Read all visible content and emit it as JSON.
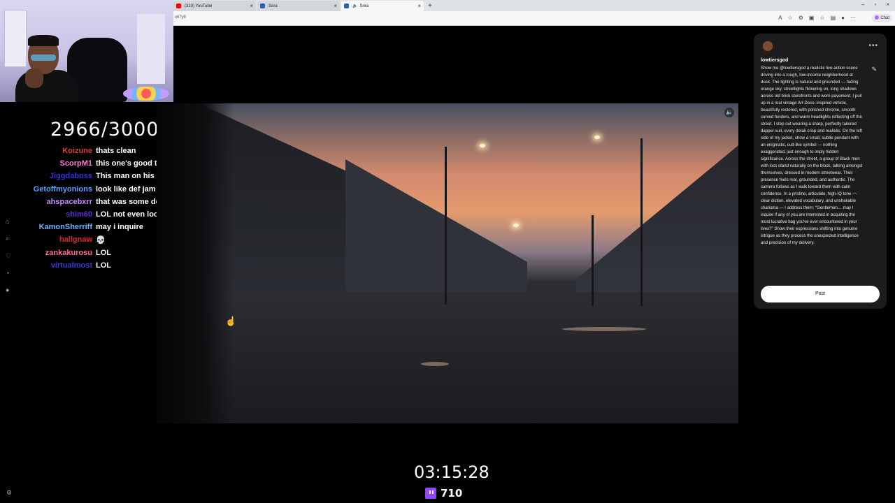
{
  "browser": {
    "tabs": [
      {
        "label": "(310) YouTube",
        "favicon_color": "#ff0000",
        "active": false,
        "audio": false
      },
      {
        "label": "Sora",
        "favicon_color": "#2f5fa8",
        "active": false,
        "audio": false
      },
      {
        "label": "Sora",
        "favicon_color": "#2f5fa8",
        "active": true,
        "audio": true
      }
    ],
    "url_fragment": "x67y8",
    "chat_button": "Chat"
  },
  "overlay": {
    "goal": "2966/3000",
    "timer": "03:15:28",
    "viewers": "710"
  },
  "chat": [
    {
      "user": "Koizune",
      "color": "#e03a3a",
      "message": "thats clean"
    },
    {
      "user": "ScorpM1",
      "color": "#ff7ad9",
      "message": "this one's good tho"
    },
    {
      "user": "Jiggdaboss",
      "color": "#3a2fd8",
      "message": "This man on his Ghost shit"
    },
    {
      "user": "Getoffmyonions",
      "color": "#5aa2ff",
      "message": "look like def jam fight for NY"
    },
    {
      "user": "ahspacebxrr",
      "color": "#c28aff",
      "message": "that was some def jam type shit"
    },
    {
      "user": "shim60",
      "color": "#5b2fd0",
      "message": "LOL not even looking at them"
    },
    {
      "user": "KamonSherriff",
      "color": "#6fb7ff",
      "message": "may i inquire"
    },
    {
      "user": "hallgnaw",
      "color": "#d32b2b",
      "message": "💀"
    },
    {
      "user": "zankakurosu",
      "color": "#ff6b8a",
      "message": "LOL"
    },
    {
      "user": "virtualmost",
      "color": "#3a36d8",
      "message": "LOL"
    }
  ],
  "panel": {
    "username": "lowtiersgod",
    "prompt": "Show me @lowtiersgod a realistic live-action scene driving into a rough, low-income neighborhood at dusk. The lighting is natural and grounded — fading orange sky, streetlights flickering on, long shadows across old brick storefronts and worn pavement. I pull up in a real vintage Art Deco–inspired vehicle, beautifully restored, with polished chrome, smooth curved fenders, and warm headlights reflecting off the street. I step out wearing a sharp, perfectly tailored dapper suit, every detail crisp and realistic. On the left side of my jacket, show a small, subtle pendant with an enigmatic, cult-like symbol — nothing exaggerated, just enough to imply hidden significance. Across the street, a group of Black men with locs stand naturally on the block, talking amongst themselves, dressed in modern streetwear. Their presence feels real, grounded, and authentic. The camera follows as I walk toward them with calm confidence. In a pristine, articulate, high-IQ tone — clear diction, elevated vocabulary, and unshakable charisma — I address them: \"Gentlemen… may I inquire if any of you are interested in acquiring the most lucrative bag you've ever encountered in your lives?\" Show their expressions shifting into genuine intrigue as they process the unexpected intelligence and precision of my delivery.",
    "post_label": "Post"
  }
}
